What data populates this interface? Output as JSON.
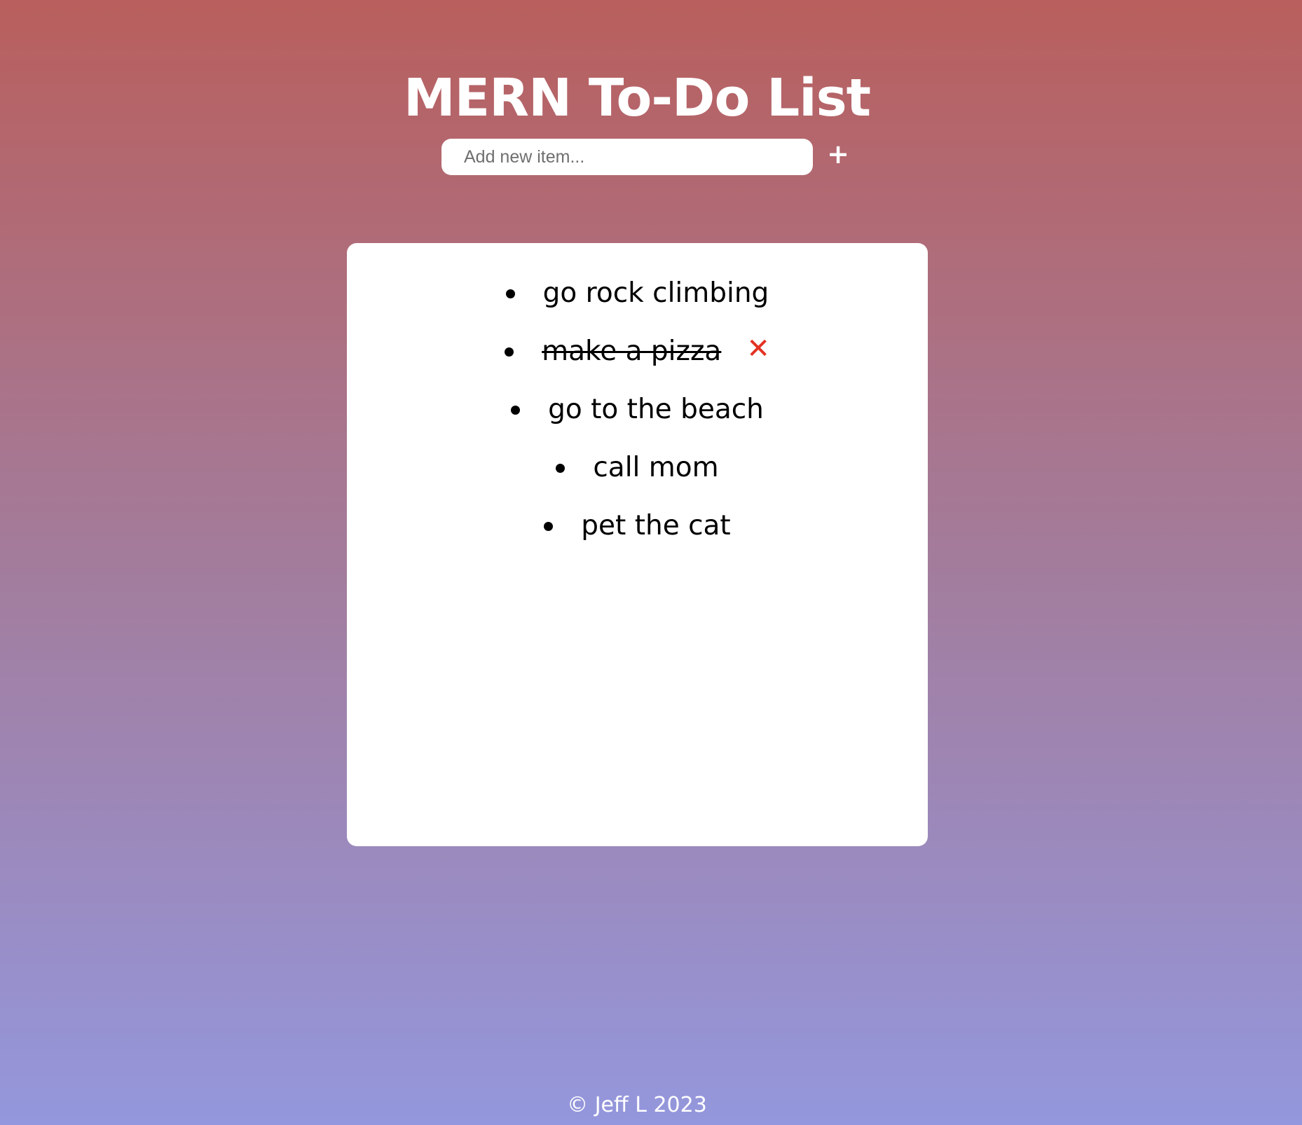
{
  "header": {
    "title": "MERN To-Do List"
  },
  "add_form": {
    "placeholder": "Add new item...",
    "value": "",
    "add_button_label": "+"
  },
  "todo": {
    "items": [
      {
        "text": "go rock climbing",
        "done": false
      },
      {
        "text": "make a pizza",
        "done": true,
        "delete_icon": "✕"
      },
      {
        "text": "go to the beach",
        "done": false
      },
      {
        "text": "call mom",
        "done": false
      },
      {
        "text": "pet the cat",
        "done": false
      }
    ]
  },
  "footer": {
    "text": "© Jeff L 2023"
  },
  "colors": {
    "gradient_top": "#b95f5d",
    "gradient_bottom": "#9497dd",
    "delete_red": "#e33122"
  },
  "icons": {
    "add": "plus-icon",
    "delete": "close-icon",
    "bullet": "bullet-icon"
  }
}
